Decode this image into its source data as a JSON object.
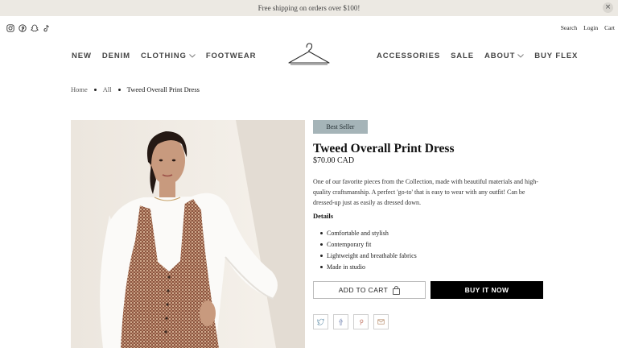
{
  "announcement": {
    "text": "Free shipping on orders over $100!",
    "close_glyph": "×"
  },
  "social_icons": [
    "instagram-icon",
    "pinterest-icon",
    "snapchat-icon",
    "tiktok-icon"
  ],
  "utility": {
    "search": "Search",
    "login": "Login",
    "cart": "Cart"
  },
  "nav_left": [
    {
      "label": "NEW",
      "dropdown": false
    },
    {
      "label": "DENIM",
      "dropdown": false
    },
    {
      "label": "CLOTHING",
      "dropdown": true
    },
    {
      "label": "FOOTWEAR",
      "dropdown": false
    }
  ],
  "nav_right": [
    {
      "label": "ACCESSORIES",
      "dropdown": false
    },
    {
      "label": "SALE",
      "dropdown": false
    },
    {
      "label": "ABOUT",
      "dropdown": true
    },
    {
      "label": "BUY FLEX",
      "dropdown": false
    }
  ],
  "breadcrumb": {
    "home": "Home",
    "all": "All",
    "current": "Tweed Overall Print Dress"
  },
  "product": {
    "badge": "Best Seller",
    "title": "Tweed Overall Print Dress",
    "price": "$70.00 CAD",
    "description": "One of our favorite pieces from the Collection, made with beautiful materials and high-quality craftsmanship. A perfect 'go-to' that is easy to wear with any outfit! Can be dressed-up just as easily as dressed down.",
    "details_heading": "Details",
    "details": [
      "Comfortable and stylish",
      "Contemporary fit",
      "Lightweight and breathable fabrics",
      "Made in studio"
    ]
  },
  "buttons": {
    "add_to_cart": "ADD TO CART",
    "buy_now": "BUY IT NOW"
  },
  "share_icons": [
    "twitter-icon",
    "facebook-icon",
    "pinterest-icon",
    "mail-icon"
  ],
  "colors": {
    "announcement_bg": "#ece9e3",
    "badge_bg": "#a5b4b8",
    "buy_bg": "#000000"
  }
}
